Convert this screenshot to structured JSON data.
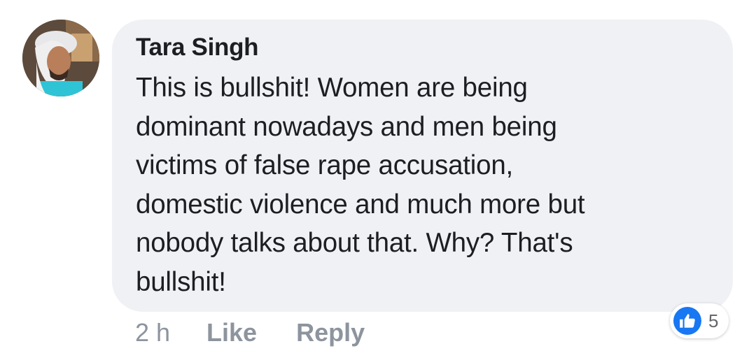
{
  "comment": {
    "author": "Tara Singh",
    "text": "This is bullshit! Women are being\ndominant nowadays and men being\nvictims of false rape accusation,\ndomestic violence and much more but\nnobody talks about that. Why? That's\nbullshit!",
    "avatar_icon": "profile-photo",
    "time": "2 h",
    "like_label": "Like",
    "reply_label": "Reply",
    "reaction_icon": "like-icon",
    "reaction_count": "5",
    "colors": {
      "bubble": "#f0f1f5",
      "text": "#1c1e21",
      "meta": "#8d949e",
      "like_blue": "#1877f2"
    }
  }
}
